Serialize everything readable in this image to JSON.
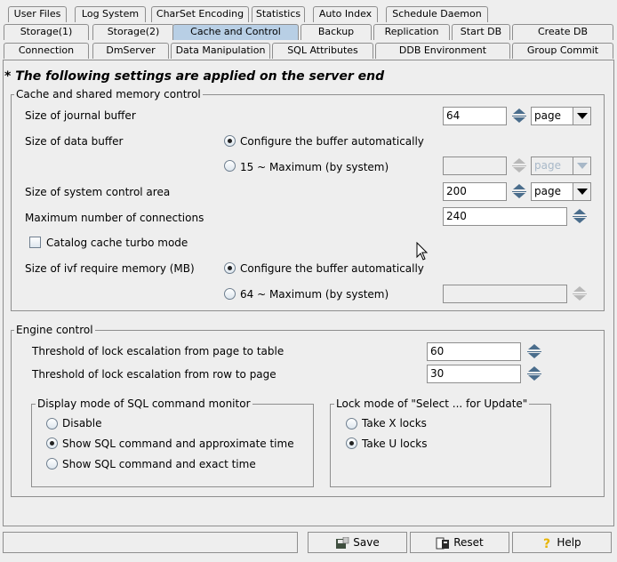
{
  "tabs": {
    "row1": [
      "User Files",
      "Log System",
      "CharSet Encoding",
      "Statistics",
      "Auto Index",
      "Schedule Daemon"
    ],
    "row2": [
      "Storage(1)",
      "Storage(2)",
      "Cache and Control",
      "Backup",
      "Replication",
      "Start DB",
      "Create DB"
    ],
    "row3": [
      "Connection",
      "DmServer",
      "Data Manipulation",
      "SQL Attributes",
      "DDB Environment",
      "Group Commit"
    ],
    "active": "Cache and Control"
  },
  "notice": "* The following settings are applied on the server end",
  "cache": {
    "legend": "Cache and shared memory control",
    "journal_label": "Size of journal buffer",
    "journal_value": "64",
    "journal_unit": "page",
    "data_buffer_label": "Size of data buffer",
    "data_auto_label": "Configure the buffer automatically",
    "data_manual_label": "15 ~ Maximum (by system)",
    "data_unit": "page",
    "syscontrol_label": "Size of system control area",
    "syscontrol_value": "200",
    "syscontrol_unit": "page",
    "maxconn_label": "Maximum number of connections",
    "maxconn_value": "240",
    "catalog_label": "Catalog cache turbo mode",
    "ivf_label": "Size of ivf require memory (MB)",
    "ivf_auto_label": "Configure the buffer automatically",
    "ivf_manual_label": "64 ~ Maximum (by system)"
  },
  "engine": {
    "legend": "Engine control",
    "page_table_label": "Threshold of lock escalation from page to table",
    "page_table_value": "60",
    "row_page_label": "Threshold of lock escalation from row to page",
    "row_page_value": "30",
    "monitor_legend": "Display mode of SQL command monitor",
    "monitor_options": [
      "Disable",
      "Show SQL command and approximate time",
      "Show SQL command and exact time"
    ],
    "monitor_selected": 1,
    "lock_legend": "Lock mode of \"Select ... for Update\"",
    "lock_options": [
      "Take X locks",
      "Take U locks"
    ],
    "lock_selected": 1
  },
  "buttons": {
    "save": "Save",
    "reset": "Reset",
    "help": "Help"
  },
  "icons": {
    "save": "save-disk-icon",
    "reset": "reset-icon",
    "help": "help-question-icon",
    "cursor": "mouse-pointer-icon"
  },
  "colors": {
    "active_tab": "#b8cfe5",
    "background": "#eeeeee",
    "spinner": "#4a6d8c"
  }
}
